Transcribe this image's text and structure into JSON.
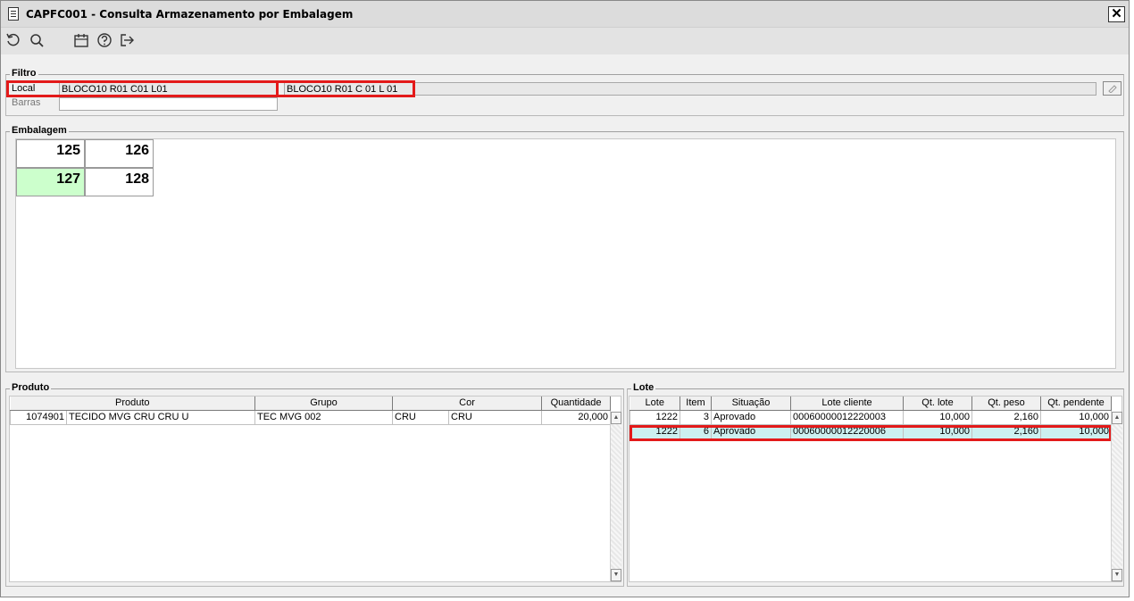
{
  "window": {
    "title": "CAPFC001 - Consulta Armazenamento por Embalagem",
    "close": "✕"
  },
  "toolbar": {
    "icons": [
      "refresh-icon",
      "search-icon",
      "calendar-icon",
      "help-icon",
      "exit-icon"
    ]
  },
  "filtro": {
    "legend": "Filtro",
    "local_label": "Local",
    "local_value": "BLOCO10 R01 C01 L01",
    "local_desc": "BLOCO10 R01 C 01 L 01",
    "barras_label": "Barras",
    "barras_value": ""
  },
  "embalagem": {
    "legend": "Embalagem",
    "cells": [
      "125",
      "126",
      "127",
      "128"
    ],
    "selected": "127"
  },
  "produto": {
    "legend": "Produto",
    "columns": [
      "Produto",
      "Grupo",
      "Cor",
      "Quantidade"
    ],
    "rows": [
      {
        "code": "1074901",
        "name": "TECIDO MVG CRU CRU U",
        "grupo": "TEC MVG 002",
        "cor1": "CRU",
        "cor2": "CRU",
        "quantidade": "20,000"
      }
    ]
  },
  "lote": {
    "legend": "Lote",
    "columns": [
      "Lote",
      "Item",
      "Situação",
      "Lote cliente",
      "Qt. lote",
      "Qt. peso",
      "Qt. pendente"
    ],
    "rows": [
      {
        "lote": "1222",
        "item": "3",
        "situacao": "Aprovado",
        "lote_cliente": "00060000012220003",
        "qt_lote": "10,000",
        "qt_peso": "2,160",
        "qt_pendente": "10,000"
      },
      {
        "lote": "1222",
        "item": "6",
        "situacao": "Aprovado",
        "lote_cliente": "00060000012220006",
        "qt_lote": "10,000",
        "qt_peso": "2,160",
        "qt_pendente": "10,000"
      }
    ],
    "highlighted_row": 1
  },
  "colors": {
    "highlight_red": "#e31a1a",
    "selected_cell": "#ccffcc",
    "selected_row": "#ccf0f0"
  }
}
